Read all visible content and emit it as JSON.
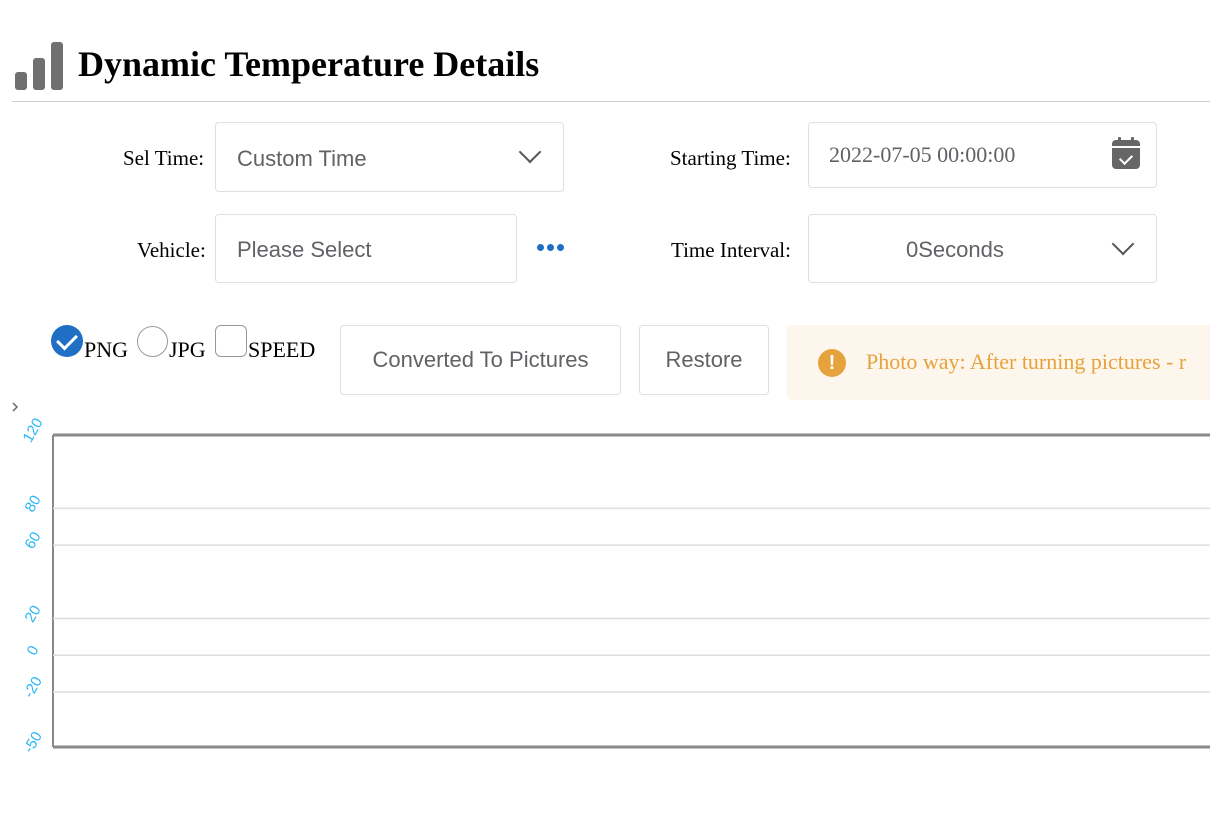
{
  "header": {
    "title": "Dynamic Temperature Details",
    "icon": "bar-signal-icon"
  },
  "form": {
    "sel_time_label": "Sel Time:",
    "sel_time_value": "Custom Time",
    "starting_time_label": "Starting Time:",
    "starting_time_value": "2022-07-05 00:00:00",
    "vehicle_label": "Vehicle:",
    "vehicle_placeholder": "Please Select",
    "time_interval_label": "Time Interval:",
    "time_interval_value": "0Seconds"
  },
  "options": {
    "png_label": "PNG",
    "png_checked": true,
    "jpg_label": "JPG",
    "jpg_checked": false,
    "speed_label": "SPEED",
    "speed_checked": false
  },
  "buttons": {
    "convert_label": "Converted To Pictures",
    "restore_label": "Restore"
  },
  "alert": {
    "text": "Photo way: After turning pictures - r",
    "color": "#e6a23c"
  },
  "colors": {
    "accent": "#1f6fc5",
    "tick_label": "#29b6f6",
    "alert_bg": "#fdf6ec"
  },
  "chart_data": {
    "type": "line",
    "title": "",
    "xlabel": "",
    "ylabel": "",
    "ylim": [
      -50,
      120
    ],
    "yticks": [
      120,
      80,
      60,
      20,
      0,
      -20,
      -50
    ],
    "grid": true,
    "series": []
  }
}
